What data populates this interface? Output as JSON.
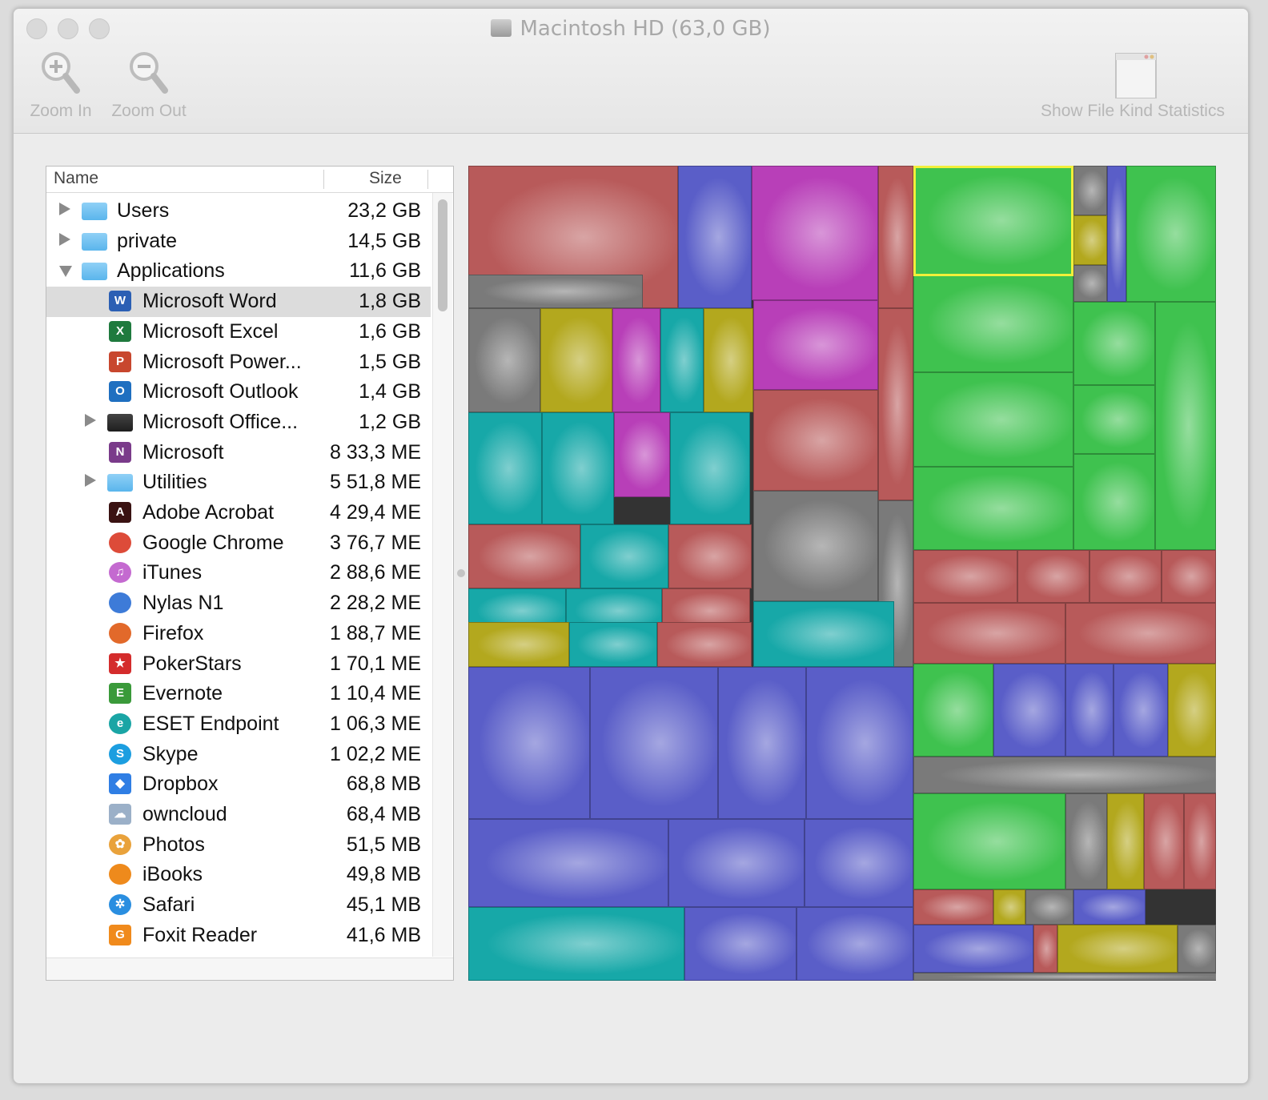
{
  "window": {
    "title": "Macintosh HD (63,0 GB)"
  },
  "toolbar": {
    "zoom_in_label": "Zoom In",
    "zoom_out_label": "Zoom Out",
    "stats_label": "Show File Kind Statistics"
  },
  "outline": {
    "col_name": "Name",
    "col_size": "Size",
    "rows": [
      {
        "name": "Users",
        "size": "23,2 GB",
        "icon": "folder-users-icon"
      },
      {
        "name": "private",
        "size": "14,5 GB",
        "icon": "folder-icon"
      },
      {
        "name": "Applications",
        "size": "11,6 GB",
        "icon": "folder-applications-icon"
      },
      {
        "name": "Microsoft Word",
        "size": "1,8 GB",
        "icon": "word-icon"
      },
      {
        "name": "Microsoft Excel",
        "size": "1,6 GB",
        "icon": "excel-icon"
      },
      {
        "name": "Microsoft Power...",
        "size": "1,5 GB",
        "icon": "powerpoint-icon"
      },
      {
        "name": "Microsoft Outlook",
        "size": "1,4 GB",
        "icon": "outlook-icon"
      },
      {
        "name": "Microsoft Office...",
        "size": "1,2 GB",
        "icon": "folder-dark-icon"
      },
      {
        "name": "Microsoft",
        "size": "8 33,3 ME",
        "icon": "onenote-icon"
      },
      {
        "name": "Utilities",
        "size": "5 51,8 ME",
        "icon": "folder-utilities-icon"
      },
      {
        "name": "Adobe Acrobat",
        "size": "4 29,4 ME",
        "icon": "acrobat-icon"
      },
      {
        "name": "Google Chrome",
        "size": "3 76,7 ME",
        "icon": "chrome-icon"
      },
      {
        "name": "iTunes",
        "size": "2 88,6 ME",
        "icon": "itunes-icon"
      },
      {
        "name": "Nylas N1",
        "size": "2 28,2 ME",
        "icon": "nylas-icon"
      },
      {
        "name": "Firefox",
        "size": "1 88,7 ME",
        "icon": "firefox-icon"
      },
      {
        "name": "PokerStars",
        "size": "1 70,1 ME",
        "icon": "pokerstars-icon"
      },
      {
        "name": "Evernote",
        "size": "1 10,4 ME",
        "icon": "evernote-icon"
      },
      {
        "name": "ESET Endpoint",
        "size": "1 06,3 ME",
        "icon": "eset-icon"
      },
      {
        "name": "Skype",
        "size": "1 02,2 ME",
        "icon": "skype-icon"
      },
      {
        "name": "Dropbox",
        "size": "68,8 MB",
        "icon": "dropbox-icon"
      },
      {
        "name": "owncloud",
        "size": "68,4 MB",
        "icon": "owncloud-icon"
      },
      {
        "name": "Photos",
        "size": "51,5 MB",
        "icon": "photos-icon"
      },
      {
        "name": "iBooks",
        "size": "49,8 MB",
        "icon": "ibooks-icon"
      },
      {
        "name": "Safari",
        "size": "45,1 MB",
        "icon": "safari-icon"
      },
      {
        "name": "Foxit Reader",
        "size": "41,6 MB",
        "icon": "foxit-icon"
      }
    ]
  },
  "treemap_colors": {
    "red": "#b85a5a",
    "green": "#3fc24f",
    "blue": "#5a5ec8",
    "magenta": "#b83fb8",
    "cyan": "#17a8a8",
    "yellow": "#b3a81e",
    "gray": "#7a7a7a",
    "selection": "#f2ef3a"
  }
}
